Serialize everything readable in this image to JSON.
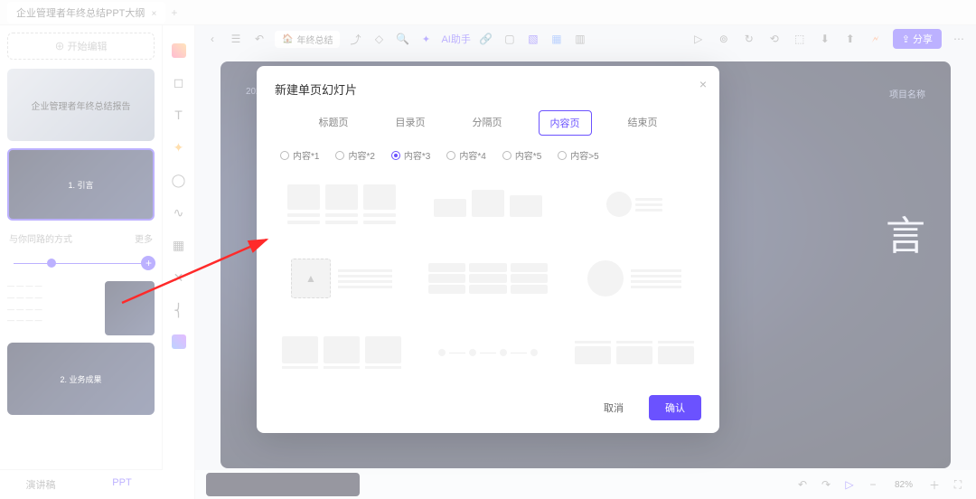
{
  "tab": {
    "name": "企业管理者年终总结PPT大纲",
    "close": "×"
  },
  "sidebar": {
    "add_page": "⊕ 开始编辑",
    "slides": [
      {
        "title": "企业管理者年终总结报告"
      },
      {
        "title": "1. 引言"
      },
      {
        "title": "2. 业务成果"
      }
    ],
    "section_label": "与你同路的方式",
    "section_more": "更多",
    "list_line": "— — — —",
    "bottom_tabs": {
      "left": "演讲稿",
      "right": "PPT"
    }
  },
  "topbar": {
    "back": "‹",
    "menu": "☰",
    "undo": "↶",
    "doc_chip": "年终总结",
    "export": "⤴",
    "tag": "◇",
    "search": "🔍",
    "ai_icon": "✦",
    "ai_label": "AI助手",
    "chain": "🔗",
    "sq": "▢",
    "layers": "▧",
    "sq2": "▦",
    "grid": "▥",
    "right": {
      "play": "▷",
      "record": "⊚",
      "refresh": "↻",
      "history": "⟲",
      "cube": "⬚",
      "down": "⬇",
      "up": "⬆",
      "bolt": "🗲",
      "share": "⇪ 分享",
      "more": "⋯"
    }
  },
  "canvas": {
    "year": "2023",
    "project": "项目名称",
    "bigtext": "言"
  },
  "modal": {
    "title": "新建单页幻灯片",
    "close": "×",
    "tabs": [
      "标题页",
      "目录页",
      "分隔页",
      "内容页",
      "结束页"
    ],
    "active_tab": 3,
    "radios": [
      "内容*1",
      "内容*2",
      "内容*3",
      "内容*4",
      "内容*5",
      "内容>5"
    ],
    "sel_radio": 2,
    "cancel": "取消",
    "ok": "确认"
  },
  "bottom": {
    "zoom": "82%",
    "icons": {
      "undo": "↶",
      "redo": "↷",
      "play": "▷",
      "minus": "−",
      "slider": "━●━",
      "plus": "＋",
      "fit": "⛶"
    }
  }
}
